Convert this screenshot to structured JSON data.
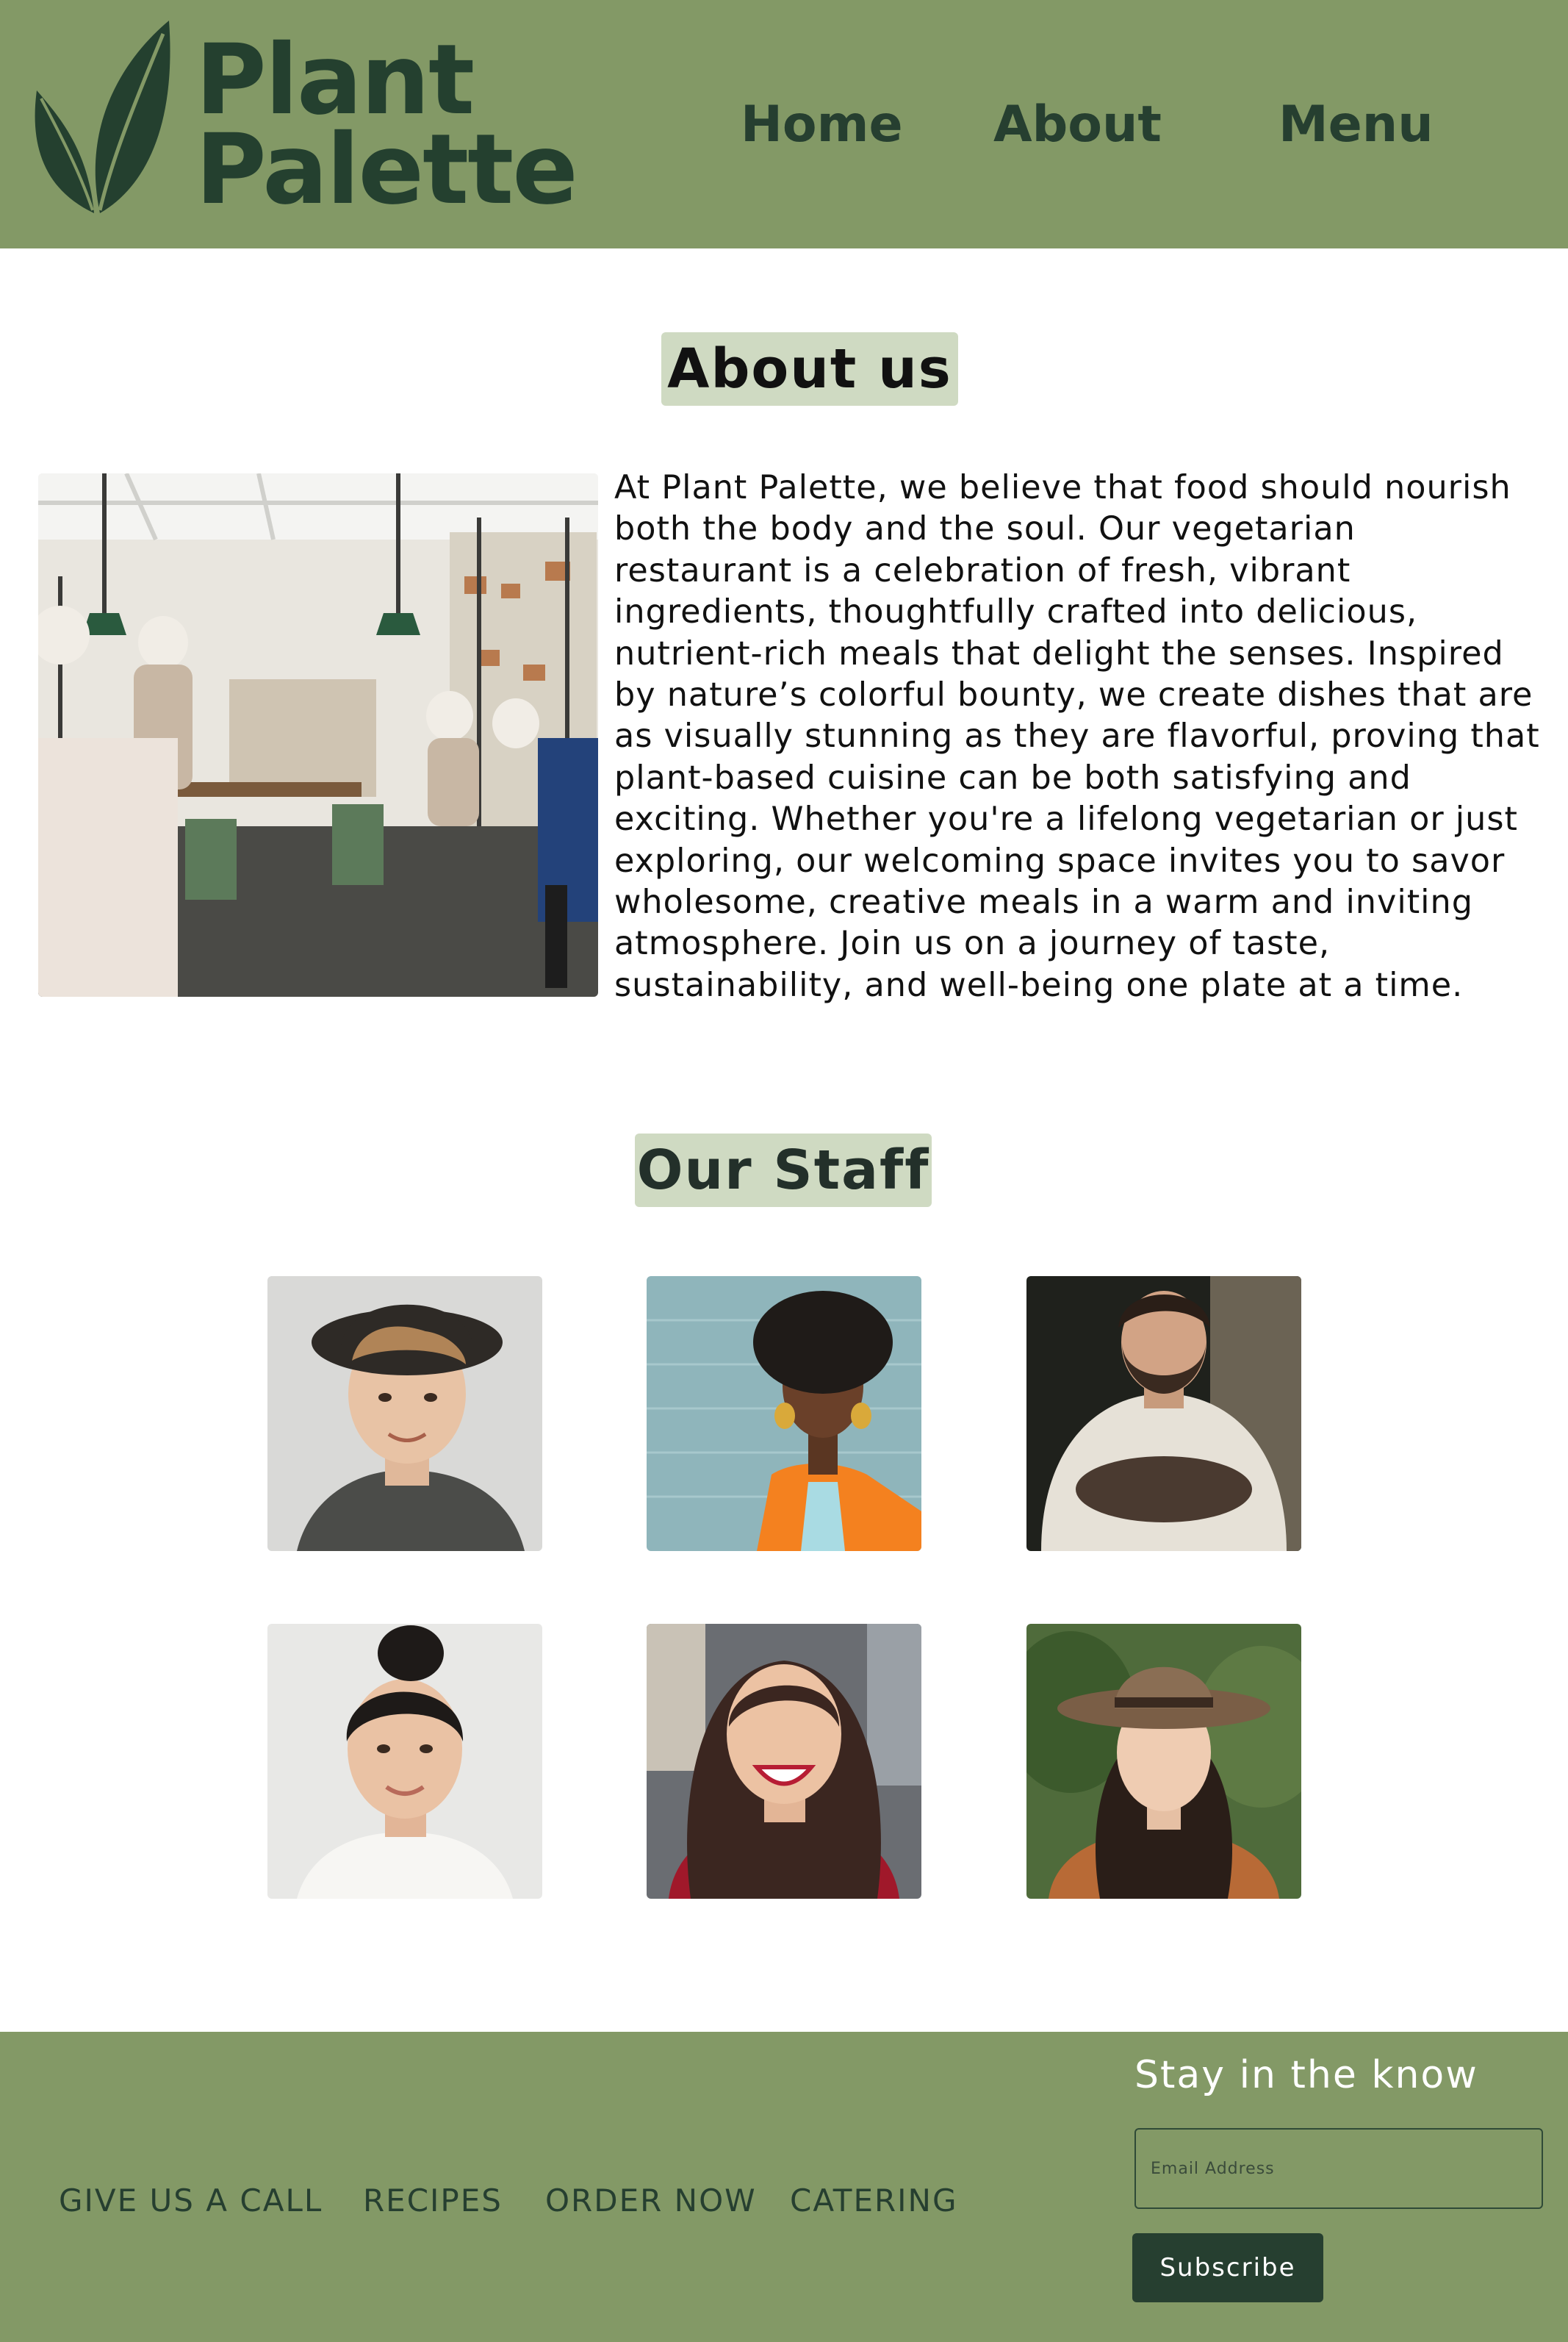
{
  "header": {
    "logo": {
      "line1": "Plant",
      "line2": "Palette",
      "icon": "leaf-icon"
    },
    "nav": [
      {
        "label": "Home"
      },
      {
        "label": "About"
      },
      {
        "label": "Menu"
      }
    ]
  },
  "about": {
    "title": "About us",
    "body": "At Plant Palette, we believe that food should nourish both the body and the soul. Our vegetarian restaurant is a celebration of fresh, vibrant ingredients, thoughtfully crafted into delicious, nutrient-rich meals that delight the senses. Inspired by nature’s colorful bounty, we create dishes that are as visually stunning as they are flavorful, proving that plant-based cuisine can be both satisfying and exciting. Whether you're a lifelong vegetarian or just exploring, our welcoming space invites you to savor wholesome, creative meals in a warm and inviting atmosphere. Join us on a journey of taste, sustainability, and well-being one plate at a time."
  },
  "staff": {
    "title": "Our Staff"
  },
  "footer": {
    "links": [
      {
        "label": "GIVE US A CALL"
      },
      {
        "label": "RECIPES"
      },
      {
        "label": "ORDER NOW"
      },
      {
        "label": "CATERING"
      }
    ],
    "newsletter": {
      "heading": "Stay in the know",
      "placeholder": "Email Address",
      "button": "Subscribe"
    }
  },
  "colors": {
    "brand_green": "#839966",
    "dark_green": "#263f30",
    "title_badge": "#cfdac2"
  }
}
